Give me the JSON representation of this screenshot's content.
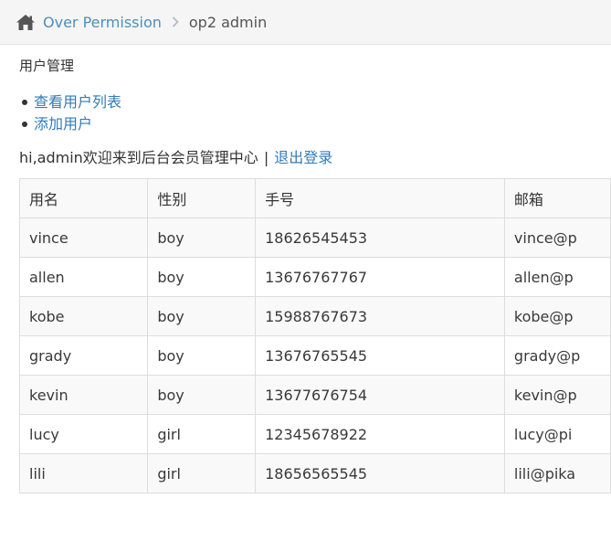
{
  "breadcrumb": {
    "home_icon": "home-icon",
    "root_label": "Over Permission",
    "current_label": "op2 admin"
  },
  "section_title": "用户管理",
  "menu": {
    "items": [
      {
        "label": "查看用户列表"
      },
      {
        "label": "添加用户"
      }
    ]
  },
  "welcome": {
    "text": "hi,admin欢迎来到后台会员管理中心",
    "separator": "|",
    "logout_label": "退出登录"
  },
  "table": {
    "headers": [
      "用名",
      "性别",
      "手号",
      "邮箱"
    ],
    "rows": [
      [
        "vince",
        "boy",
        "18626545453",
        "vince@p"
      ],
      [
        "allen",
        "boy",
        "13676767767",
        "allen@p"
      ],
      [
        "kobe",
        "boy",
        "15988767673",
        "kobe@p"
      ],
      [
        "grady",
        "boy",
        "13676765545",
        "grady@p"
      ],
      [
        "kevin",
        "boy",
        "13677676754",
        "kevin@p"
      ],
      [
        "lucy",
        "girl",
        "12345678922",
        "lucy@pi"
      ],
      [
        "lili",
        "girl",
        "18656565545",
        "lili@pika"
      ]
    ]
  },
  "colors": {
    "link": "#337ab7",
    "breadcrumb_link": "#4c8fbd",
    "breadcrumb_bg": "#f5f5f5",
    "table_border": "#dddddd",
    "table_stripe": "#f9f9f9"
  }
}
